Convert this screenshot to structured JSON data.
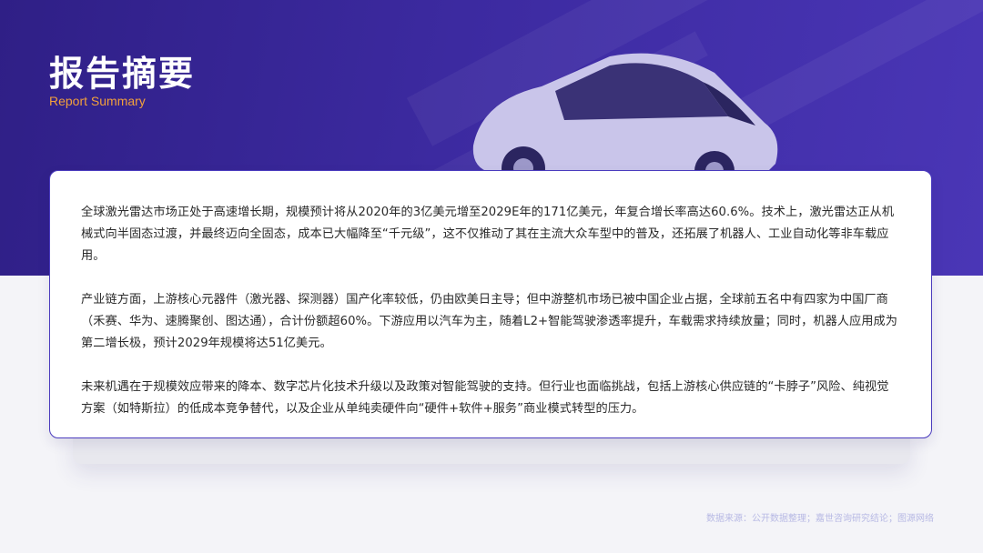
{
  "header": {
    "title": "报告摘要",
    "subtitle": "Report Summary"
  },
  "summary": {
    "paragraphs": [
      "全球激光雷达市场正处于高速增长期，规模预计将从2020年的3亿美元增至2029E年的171亿美元，年复合增长率高达60.6%。技术上，激光雷达正从机械式向半固态过渡，并最终迈向全固态，成本已大幅降至“千元级”，这不仅推动了其在主流大众车型中的普及，还拓展了机器人、工业自动化等非车载应用。",
      "产业链方面，上游核心元器件（激光器、探测器）国产化率较低，仍由欧美日主导；但中游整机市场已被中国企业占据，全球前五名中有四家为中国厂商（禾赛、华为、速腾聚创、图达通），合计份额超60%。下游应用以汽车为主，随着L2+智能驾驶渗透率提升，车载需求持续放量；同时，机器人应用成为第二增长极，预计2029年规模将达51亿美元。",
      "未来机遇在于规模效应带来的降本、数字芯片化技术升级以及政策对智能驾驶的支持。但行业也面临挑战，包括上游核心供应链的“卡脖子”风险、纯视觉方案（如特斯拉）的低成本竞争替代，以及企业从单纯卖硬件向“硬件+软件+服务”商业模式转型的压力。"
    ]
  },
  "footer": {
    "source": "数据来源：公开数据整理；嘉世咨询研究结论；图源网络"
  },
  "colors": {
    "hero": "#3c2aa0",
    "accent": "#f2a03c",
    "card_border": "#4b3cbe"
  }
}
